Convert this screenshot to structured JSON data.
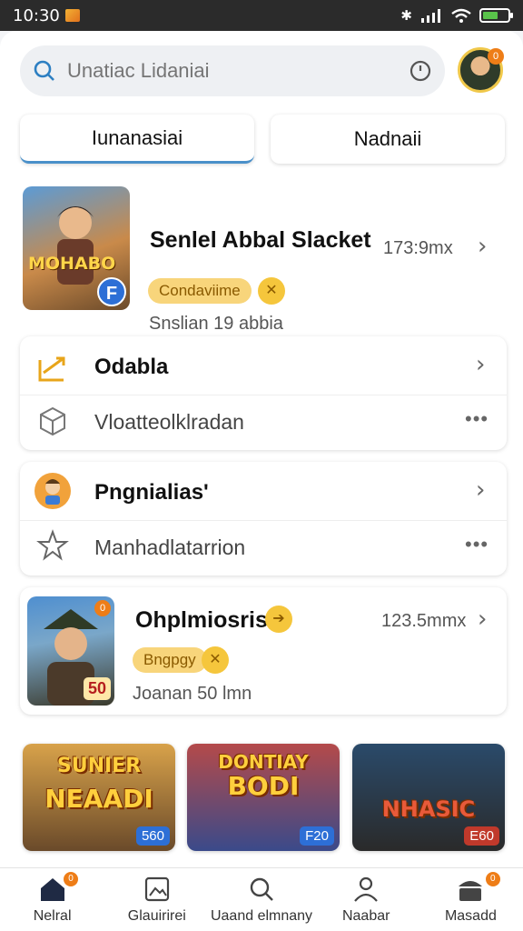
{
  "status": {
    "time": "10:30"
  },
  "search": {
    "placeholder": "Unatiac Lidaniai"
  },
  "avatar_badge": "0",
  "tabs": [
    "Iunanasiai",
    "Nadnaii"
  ],
  "featured": {
    "title": "Senlel Abbal Slacket",
    "meta": "173:9mx",
    "tag": "Condaviime",
    "subtitle": "Snslian 19 abbia",
    "thumb_label": "MOHABO",
    "thumb_badge": "F"
  },
  "menu_group_1": {
    "title": "Odabla",
    "row": "Vloatteolklradan"
  },
  "menu_group_2": {
    "title": "Pngnialias'",
    "row": "Manhadlatarrion"
  },
  "second": {
    "title": "Ohplmiosris",
    "meta": "123.5mmx",
    "tag": "Bngpgy",
    "subtitle": "Joanan 50 lmn",
    "badge_top": "0",
    "badge_bottom": "50"
  },
  "tiles": [
    {
      "label": "NEAADI",
      "top": "SUNIER",
      "badge": "560"
    },
    {
      "label": "BODI",
      "top": "DONTIAY",
      "badge": "F20"
    },
    {
      "label": "NHASIC",
      "top": "",
      "badge": "E60"
    }
  ],
  "nav": [
    {
      "label": "Nelral",
      "icon": "home-icon",
      "badge": "0"
    },
    {
      "label": "Glauirirei",
      "icon": "gallery-icon",
      "badge": ""
    },
    {
      "label": "Uaand elmnany",
      "icon": "search-icon",
      "badge": ""
    },
    {
      "label": "Naabar",
      "icon": "people-icon",
      "badge": ""
    },
    {
      "label": "Masadd",
      "icon": "store-icon",
      "badge": "0"
    }
  ],
  "colors": {
    "accent": "#4a90c9",
    "pill": "#f8d57b",
    "badge": "#ee7d17"
  }
}
